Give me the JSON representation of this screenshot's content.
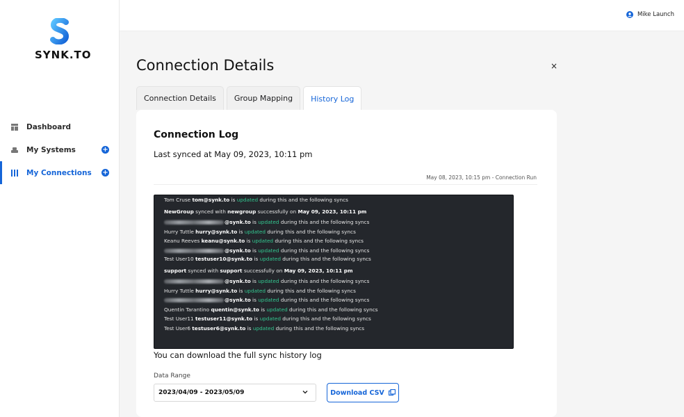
{
  "brand": {
    "name": "SYNK.TO",
    "color": "#1565d8"
  },
  "sidebar": {
    "items": [
      {
        "label": "Dashboard",
        "icon": "dashboard-icon",
        "active": false,
        "has_add": false
      },
      {
        "label": "My Systems",
        "icon": "systems-icon",
        "active": false,
        "has_add": true
      },
      {
        "label": "My Connections",
        "icon": "connections-icon",
        "active": true,
        "has_add": true
      }
    ]
  },
  "topbar": {
    "user_name": "Mike Launch",
    "user_icon": "user-circle-icon"
  },
  "page": {
    "title": "Connection Details",
    "close_glyph": "×"
  },
  "tabs": [
    {
      "label": "Connection Details",
      "active": false
    },
    {
      "label": "Group Mapping",
      "active": false
    },
    {
      "label": "History Log",
      "active": true
    }
  ],
  "log_card": {
    "title": "Connection Log",
    "last_synced": "Last synced at May 09, 2023, 10:11 pm",
    "run_info": "May 08, 2023, 10:15 pm - Connection Run",
    "status_word": "updated",
    "suffix": "during this and the following syncs",
    "lines": [
      {
        "type": "user",
        "name": "Tom Cruse",
        "email": "tom@synk.to",
        "redacted": false
      },
      {
        "type": "group",
        "group": "NewGroup",
        "with": "newgroup",
        "date": "May 09, 2023, 10:11 pm"
      },
      {
        "type": "user",
        "name": "",
        "email": "@synk.to",
        "redacted": true
      },
      {
        "type": "user",
        "name": "Hurry Tuttle",
        "email": "hurry@synk.to",
        "redacted": false
      },
      {
        "type": "user",
        "name": "Keanu Reeves",
        "email": "keanu@synk.to",
        "redacted": false
      },
      {
        "type": "user",
        "name": "",
        "email": "@synk.to",
        "redacted": true
      },
      {
        "type": "user",
        "name": "Test User10",
        "email": "testuser10@synk.to",
        "redacted": false
      },
      {
        "type": "group",
        "group": "support",
        "with": "support",
        "date": "May 09, 2023, 10:11 pm"
      },
      {
        "type": "user",
        "name": "",
        "email": "@synk.to",
        "redacted": true
      },
      {
        "type": "user",
        "name": "Hurry Tuttle",
        "email": "hurry@synk.to",
        "redacted": false
      },
      {
        "type": "user",
        "name": "",
        "email": "@synk.to",
        "redacted": true
      },
      {
        "type": "user",
        "name": "Quentin Tarantino",
        "email": "quentin@synk.to",
        "redacted": false
      },
      {
        "type": "user",
        "name": "Test User11",
        "email": "testuser11@synk.to",
        "redacted": false
      },
      {
        "type": "user",
        "name": "Test User6",
        "email": "testuser6@synk.to",
        "redacted": false
      }
    ],
    "download_text": "You can download the full sync history log",
    "range_label": "Data Range",
    "range_value": "2023/04/09 - 2023/05/09",
    "download_button": "Download CSV"
  }
}
